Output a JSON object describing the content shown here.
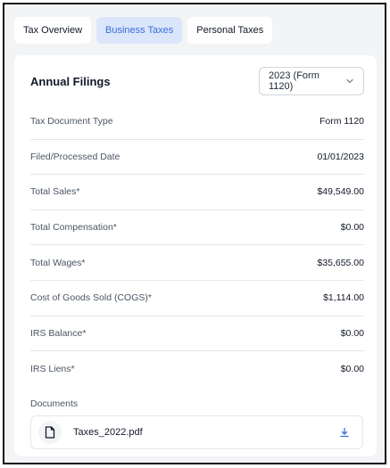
{
  "tabs": [
    {
      "label": "Tax Overview",
      "active": false
    },
    {
      "label": "Business Taxes",
      "active": true
    },
    {
      "label": "Personal Taxes",
      "active": false
    }
  ],
  "card": {
    "title": "Annual Filings",
    "year_select": {
      "value": "2023 (Form 1120)",
      "icon": "chevron-down-icon"
    }
  },
  "rows": [
    {
      "label": "Tax Document Type",
      "value": "Form 1120"
    },
    {
      "label": "Filed/Processed Date",
      "value": "01/01/2023"
    },
    {
      "label": "Total Sales*",
      "value": "$49,549.00"
    },
    {
      "label": "Total Compensation*",
      "value": "$0.00"
    },
    {
      "label": "Total Wages*",
      "value": "$35,655.00"
    },
    {
      "label": "Cost of Goods Sold (COGS)*",
      "value": "$1,114.00"
    },
    {
      "label": "IRS Balance*",
      "value": "$0.00"
    },
    {
      "label": "IRS Liens*",
      "value": "$0.00"
    }
  ],
  "documents": {
    "label": "Documents",
    "items": [
      {
        "name": "Taxes_2022.pdf",
        "icon": "file-icon",
        "action_icon": "download-icon"
      }
    ]
  },
  "colors": {
    "active_tab_bg": "#dbe6fb",
    "active_tab_text": "#3b6ed6",
    "download_icon": "#3b6ed6"
  }
}
